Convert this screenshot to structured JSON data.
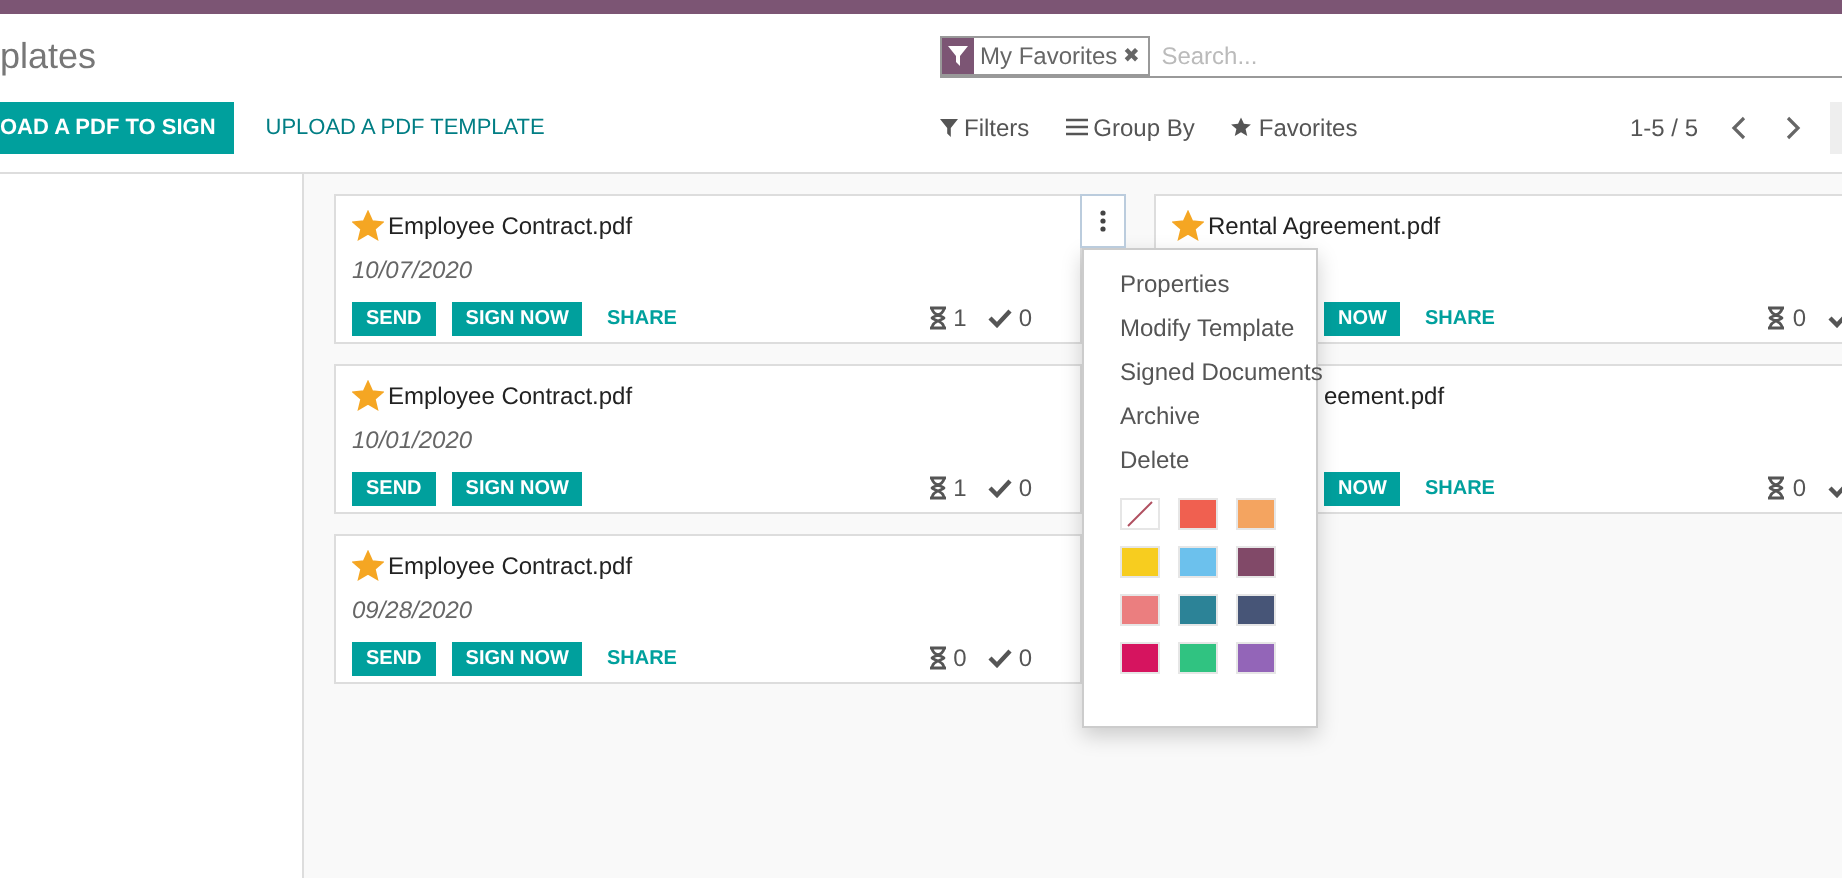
{
  "breadcrumb": "plates",
  "search": {
    "facet": {
      "label": "My Favorites",
      "remove": "✖"
    },
    "placeholder": "Search..."
  },
  "actions": [
    {
      "label": "OAD A PDF TO SIGN",
      "kind": "primary"
    },
    {
      "label": "UPLOAD A PDF TEMPLATE",
      "kind": "link"
    }
  ],
  "toolbar": [
    {
      "label": "Filters",
      "kind": "filter"
    },
    {
      "label": "Group By",
      "kind": "list"
    },
    {
      "label": "Favorites",
      "kind": "star"
    }
  ],
  "pager": "1-5 / 5",
  "columns": [
    {
      "cards": [
        {
          "kind": "full",
          "favorite": true,
          "title": "Employee Contract.pdf",
          "date": "10/07/2020",
          "buttons": [
            {
              "label": "SEND",
              "kind": "primary"
            },
            {
              "label": "SIGN NOW",
              "kind": "primary"
            },
            {
              "label": "SHARE",
              "kind": "link"
            }
          ],
          "waiting": "1",
          "signed": "0"
        },
        {
          "kind": "full",
          "favorite": true,
          "title": "Employee Contract.pdf",
          "date": "10/01/2020",
          "buttons": [
            {
              "label": "SEND",
              "kind": "primary"
            },
            {
              "label": "SIGN NOW",
              "kind": "primary"
            }
          ],
          "waiting": "1",
          "signed": "0"
        },
        {
          "kind": "full",
          "favorite": true,
          "title": "Employee Contract.pdf",
          "date": "09/28/2020",
          "buttons": [
            {
              "label": "SEND",
              "kind": "primary"
            },
            {
              "label": "SIGN NOW",
              "kind": "primary"
            },
            {
              "label": "SHARE",
              "kind": "link"
            }
          ],
          "waiting": "0",
          "signed": "0"
        }
      ]
    },
    {
      "cards": [
        {
          "kind": "body-covered",
          "favorite": true,
          "title": "Rental Agreement.pdf",
          "buttons": [
            {
              "label": "NOW",
              "kind": "primary"
            },
            {
              "label": "SHARE",
              "kind": "link"
            }
          ],
          "waiting": "0"
        },
        {
          "kind": "covered",
          "title": "eement.pdf",
          "buttons": [
            {
              "label": "NOW",
              "kind": "primary"
            },
            {
              "label": "SHARE",
              "kind": "link"
            }
          ],
          "waiting": "0"
        }
      ]
    }
  ],
  "menu": {
    "items": [
      "Properties",
      "Modify Template",
      "Signed Documents",
      "Archive",
      "Delete"
    ],
    "swatches": [
      {
        "kind": "none"
      },
      {
        "kind": "color",
        "color": "#f06050"
      },
      {
        "kind": "color",
        "color": "#f4a460"
      },
      {
        "kind": "color",
        "color": "#f7cd1f"
      },
      {
        "kind": "color",
        "color": "#6cc1ed"
      },
      {
        "kind": "color",
        "color": "#814968"
      },
      {
        "kind": "color",
        "color": "#eb7e7f"
      },
      {
        "kind": "color",
        "color": "#2c8397"
      },
      {
        "kind": "color",
        "color": "#475577"
      },
      {
        "kind": "color",
        "color": "#d6145f"
      },
      {
        "kind": "color",
        "color": "#30c381"
      },
      {
        "kind": "color",
        "color": "#9365b8"
      }
    ]
  }
}
